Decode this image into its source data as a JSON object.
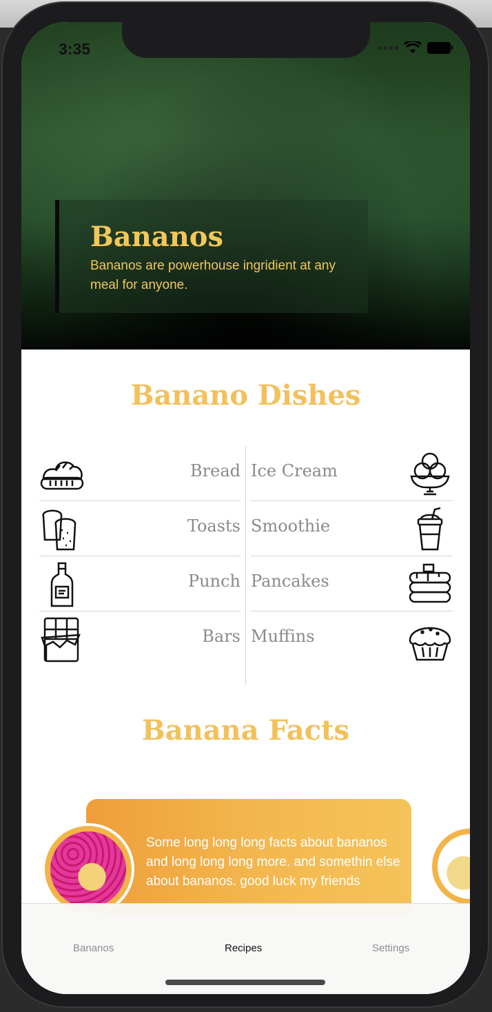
{
  "status_bar": {
    "time": "3:35"
  },
  "hero": {
    "title": "Bananos",
    "subtitle": "Bananos are powerhouse ingridient at any meal for anyone."
  },
  "dishes": {
    "title": "Banano Dishes",
    "left": [
      {
        "label": "Bread",
        "icon": "bread-icon"
      },
      {
        "label": "Toasts",
        "icon": "toast-icon"
      },
      {
        "label": "Punch",
        "icon": "bottle-icon"
      },
      {
        "label": "Bars",
        "icon": "chocolate-bar-icon"
      }
    ],
    "right": [
      {
        "label": "Ice Cream",
        "icon": "ice-cream-icon"
      },
      {
        "label": "Smoothie",
        "icon": "smoothie-icon"
      },
      {
        "label": "Pancakes",
        "icon": "pancakes-icon"
      },
      {
        "label": "Muffins",
        "icon": "muffin-icon"
      }
    ]
  },
  "facts": {
    "title": "Banana Facts",
    "cards": [
      {
        "text": "Some long long long facts about bananos and long long long more. and somethin else about bananos. good luck my friends"
      }
    ]
  },
  "tabs": {
    "items": [
      {
        "label": "Bananos",
        "active": false
      },
      {
        "label": "Recipes",
        "active": true
      },
      {
        "label": "Settings",
        "active": false
      }
    ]
  },
  "colors": {
    "accent": "#f3c05a",
    "text_muted": "#8a8a8a",
    "card_start": "#ef9e3a",
    "card_end": "#f5c35a"
  }
}
